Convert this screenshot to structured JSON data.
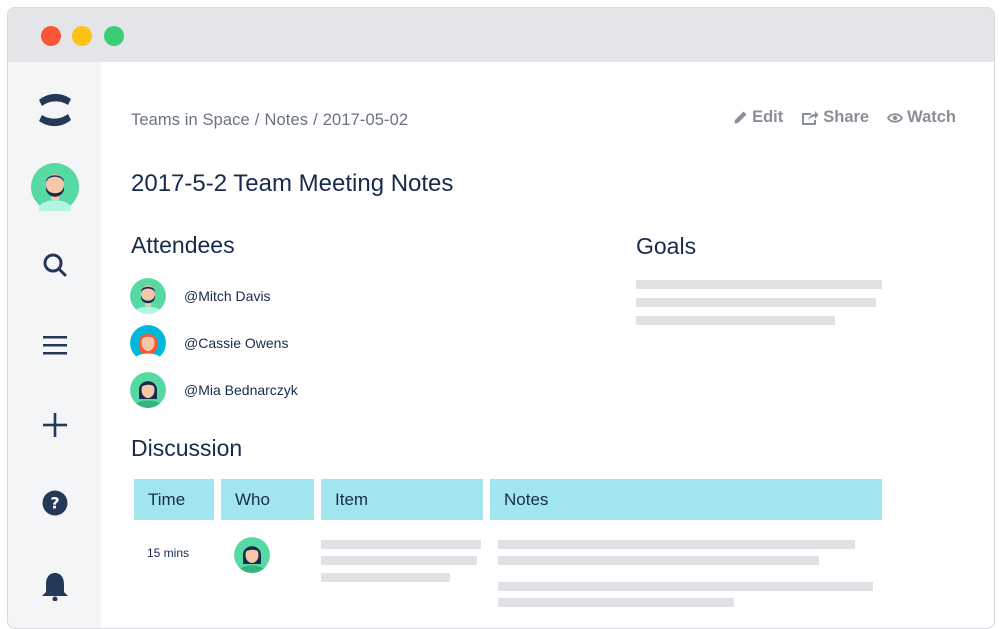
{
  "window": {
    "controls": [
      "close",
      "minimize",
      "zoom"
    ],
    "colors": {
      "close": "#fb5537",
      "minimize": "#fcc216",
      "zoom": "#3dcd74"
    }
  },
  "sidebar": {
    "items": [
      {
        "name": "confluence-logo",
        "icon": "confluence-logo-icon"
      },
      {
        "name": "user-avatar",
        "icon": "avatar-icon"
      },
      {
        "name": "search",
        "icon": "search-icon"
      },
      {
        "name": "menu",
        "icon": "menu-icon"
      },
      {
        "name": "create",
        "icon": "plus-icon"
      },
      {
        "name": "help",
        "icon": "help-icon"
      },
      {
        "name": "notifications",
        "icon": "bell-icon"
      }
    ]
  },
  "breadcrumb": {
    "items": [
      "Teams in Space",
      "Notes",
      "2017-05-02"
    ],
    "separator": "/"
  },
  "actions": {
    "edit": {
      "label": "Edit",
      "icon": "pencil-icon"
    },
    "share": {
      "label": "Share",
      "icon": "share-icon"
    },
    "watch": {
      "label": "Watch",
      "icon": "eye-icon"
    }
  },
  "page": {
    "title": "2017-5-2 Team Meeting Notes"
  },
  "attendees": {
    "heading": "Attendees",
    "people": [
      {
        "handle": "@Mitch Davis",
        "avatar": "bearded-man-avatar"
      },
      {
        "handle": "@Cassie Owens",
        "avatar": "red-haired-woman-avatar"
      },
      {
        "handle": "@Mia Bednarczyk",
        "avatar": "dark-haired-woman-avatar"
      }
    ]
  },
  "goals": {
    "heading": "Goals"
  },
  "discussion": {
    "heading": "Discussion",
    "columns": [
      "Time",
      "Who",
      "Item",
      "Notes"
    ],
    "rows": [
      {
        "time": "15 mins",
        "who_avatar": "dark-haired-woman-avatar"
      }
    ]
  },
  "colors": {
    "sidebar_bg": "#f4f5f7",
    "table_header_bg": "#a1e5ef",
    "text_primary": "#172b4d",
    "text_muted": "#6b7280",
    "placeholder_bar": "#dfe1e5"
  }
}
